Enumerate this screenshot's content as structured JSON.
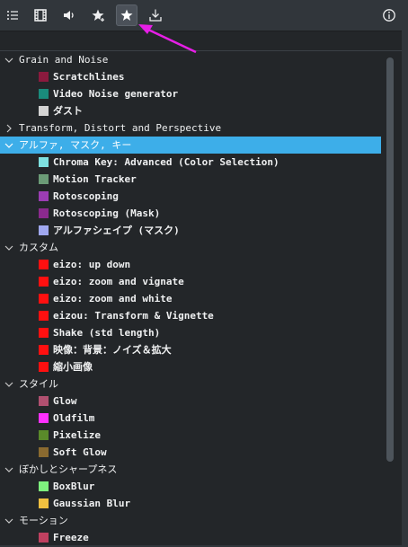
{
  "toolbar": {
    "buttons": [
      {
        "name": "list-icon"
      },
      {
        "name": "film-icon"
      },
      {
        "name": "speaker-icon"
      },
      {
        "name": "star-plus-icon"
      },
      {
        "name": "star-icon",
        "active": true
      },
      {
        "name": "download-icon"
      },
      {
        "name": "info-icon"
      }
    ]
  },
  "colors": {
    "selection": "#3daee9",
    "background": "#232629",
    "toolbar": "#31363b",
    "annotation_arrow": "#e61fe6"
  },
  "tree": {
    "categories": [
      {
        "label": "Grain and Noise",
        "expanded": true,
        "effects": [
          {
            "label": "Scratchlines",
            "color": "#8b1a3e"
          },
          {
            "label": "Video Noise generator",
            "color": "#1a8b7c"
          },
          {
            "label": "ダスト",
            "color": "#d3d3d3"
          }
        ]
      },
      {
        "label": "Transform, Distort and Perspective",
        "expanded": false,
        "effects": []
      },
      {
        "label": "アルファ, マスク, キー",
        "expanded": true,
        "selected": true,
        "effects": [
          {
            "label": "Chroma Key: Advanced (Color Selection)",
            "color": "#7ee0e0"
          },
          {
            "label": "Motion Tracker",
            "color": "#6b9b77"
          },
          {
            "label": "Rotoscoping",
            "color": "#9b3db3"
          },
          {
            "label": "Rotoscoping (Mask)",
            "color": "#8b2a8e"
          },
          {
            "label": "アルファシェイプ (マスク)",
            "color": "#a0a8f0"
          }
        ]
      },
      {
        "label": "カスタム",
        "expanded": true,
        "effects": [
          {
            "label": "eizo: up down",
            "color": "#ff1010"
          },
          {
            "label": "eizo: zoom and vignate",
            "color": "#ff1010"
          },
          {
            "label": "eizo: zoom and white",
            "color": "#ff1010"
          },
          {
            "label": "eizou: Transform & Vignette",
            "color": "#ff1010"
          },
          {
            "label": "Shake (std length)",
            "color": "#ff1010"
          },
          {
            "label": "映像：背景：ノイズ＆拡大",
            "color": "#ff1010"
          },
          {
            "label": "縮小画像",
            "color": "#ff1010"
          }
        ]
      },
      {
        "label": "スタイル",
        "expanded": true,
        "effects": [
          {
            "label": "Glow",
            "color": "#b05070"
          },
          {
            "label": "Oldfilm",
            "color": "#ff30ff"
          },
          {
            "label": "Pixelize",
            "color": "#5a8a2a"
          },
          {
            "label": "Soft Glow",
            "color": "#8a6a30"
          }
        ]
      },
      {
        "label": "ぼかしとシャープネス",
        "expanded": true,
        "effects": [
          {
            "label": "BoxBlur",
            "color": "#7ef07e"
          },
          {
            "label": "Gaussian Blur",
            "color": "#f0c040"
          }
        ]
      },
      {
        "label": "モーション",
        "expanded": true,
        "effects": [
          {
            "label": "Freeze",
            "color": "#c04060"
          }
        ]
      }
    ]
  }
}
